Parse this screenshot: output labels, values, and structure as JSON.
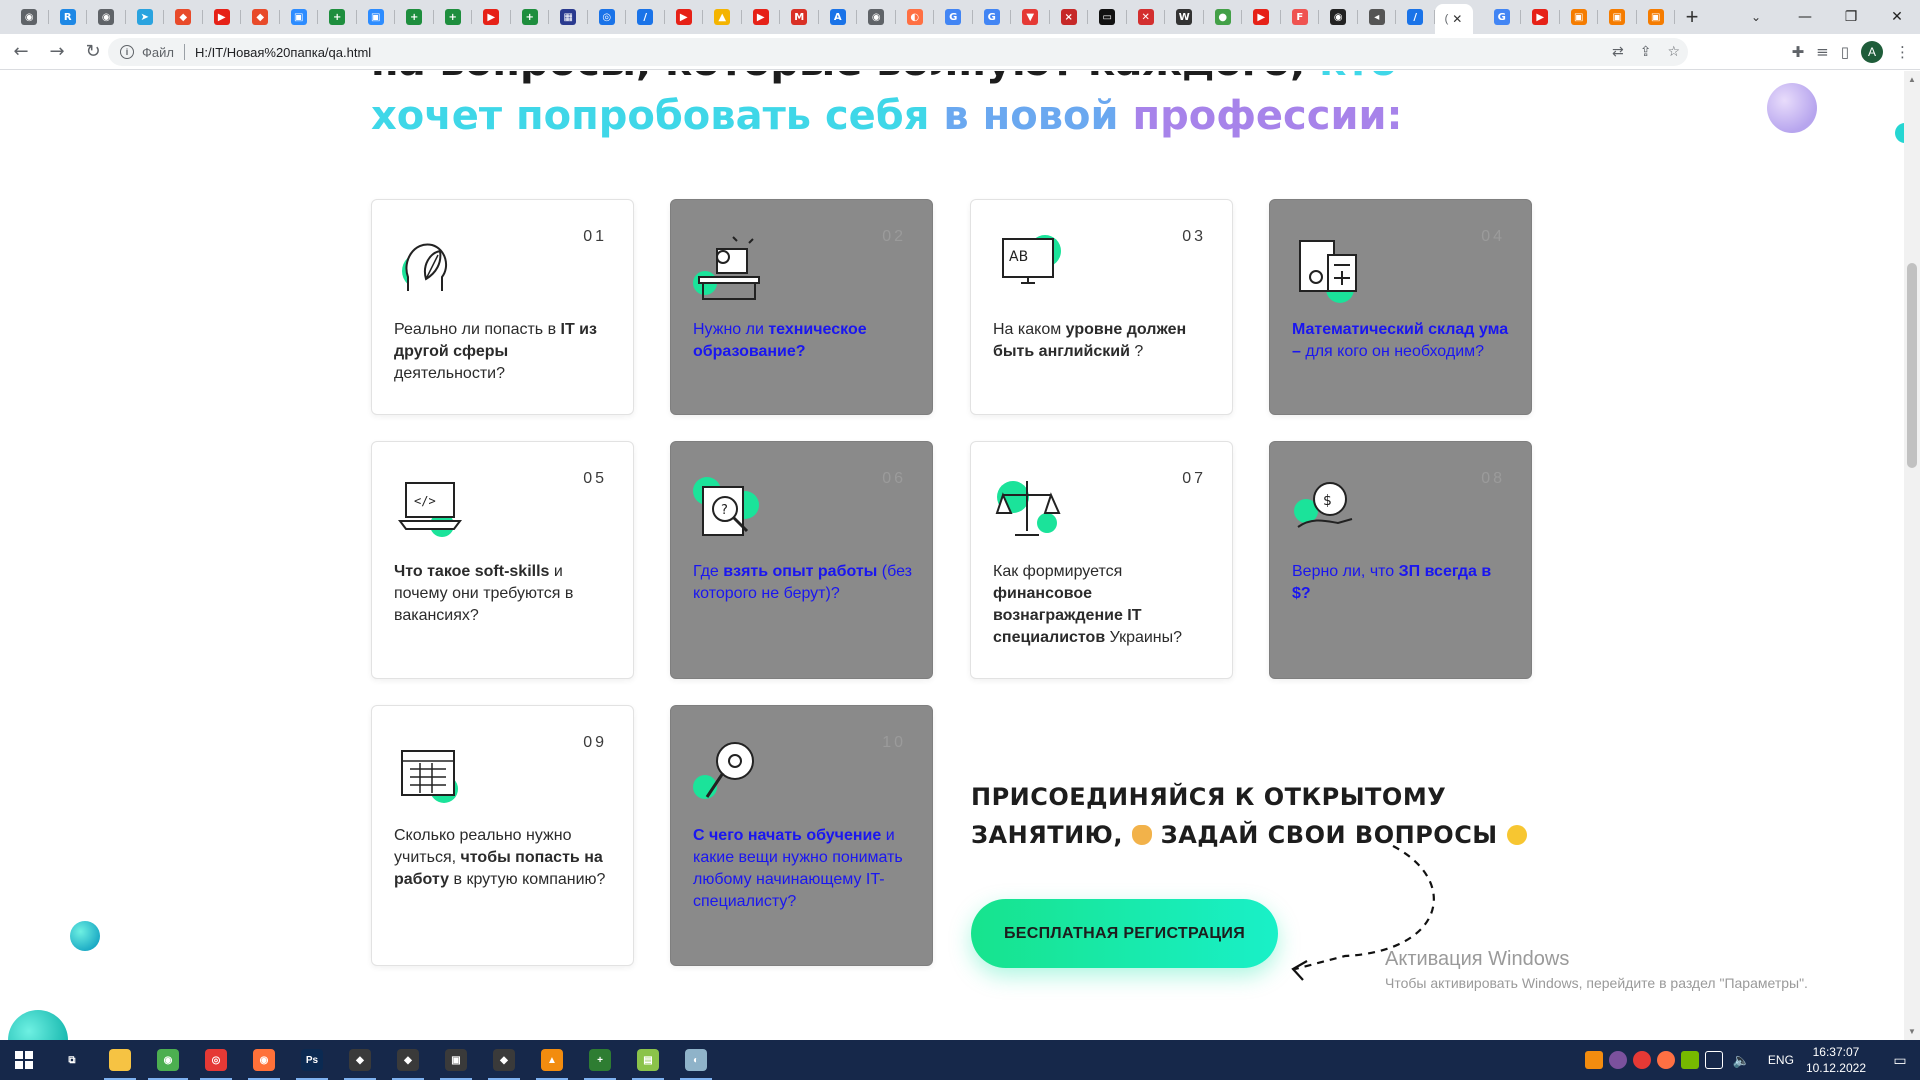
{
  "browser": {
    "tabs_pinned": [
      {
        "icon": "chrome-icon",
        "color": "#5f6368",
        "glyph": "◉"
      },
      {
        "icon": "r-icon",
        "color": "#1e88e5",
        "glyph": "R"
      },
      {
        "icon": "chrome-dark-icon",
        "color": "#5f6368",
        "glyph": "◉"
      },
      {
        "icon": "telegram-icon",
        "color": "#2aa3df",
        "glyph": "➤"
      },
      {
        "icon": "git-icon",
        "color": "#e84a2a",
        "glyph": "◆"
      },
      {
        "icon": "youtube-icon",
        "color": "#e62117",
        "glyph": "▶"
      },
      {
        "icon": "git-icon",
        "color": "#e84a2a",
        "glyph": "◆"
      },
      {
        "icon": "zoom-icon",
        "color": "#2d8cff",
        "glyph": "▣"
      },
      {
        "icon": "sheets-icon",
        "color": "#1e8e3e",
        "glyph": "+"
      },
      {
        "icon": "zoom-icon",
        "color": "#2d8cff",
        "glyph": "▣"
      },
      {
        "icon": "sheets-icon",
        "color": "#1e8e3e",
        "glyph": "+"
      },
      {
        "icon": "sheets-icon",
        "color": "#1e8e3e",
        "glyph": "+"
      },
      {
        "icon": "youtube-icon",
        "color": "#e62117",
        "glyph": "▶"
      },
      {
        "icon": "sheets-icon",
        "color": "#1e8e3e",
        "glyph": "+"
      },
      {
        "icon": "grid-icon",
        "color": "#2a3a8f",
        "glyph": "▦"
      },
      {
        "icon": "maps-icon",
        "color": "#1a73e8",
        "glyph": "◎"
      },
      {
        "icon": "pen-icon",
        "color": "#1a73e8",
        "glyph": "/"
      },
      {
        "icon": "youtube-icon",
        "color": "#e62117",
        "glyph": "▶"
      },
      {
        "icon": "drive-icon",
        "color": "#f4b400",
        "glyph": "▲"
      },
      {
        "icon": "youtube-icon",
        "color": "#e62117",
        "glyph": "▶"
      },
      {
        "icon": "gmail-icon",
        "color": "#d93025",
        "glyph": "M"
      },
      {
        "icon": "a-icon",
        "color": "#1a73e8",
        "glyph": "A"
      },
      {
        "icon": "chrome-dark-icon",
        "color": "#5f6368",
        "glyph": "◉"
      },
      {
        "icon": "swirl-icon",
        "color": "#ff7043",
        "glyph": "◐"
      },
      {
        "icon": "google-icon",
        "color": "#4285f4",
        "glyph": "G"
      },
      {
        "icon": "google-icon",
        "color": "#4285f4",
        "glyph": "G"
      },
      {
        "icon": "cup-icon",
        "color": "#e53935",
        "glyph": "▼"
      },
      {
        "icon": "xo-icon",
        "color": "#c62828",
        "glyph": "×"
      },
      {
        "icon": "tv-icon",
        "color": "#111111",
        "glyph": "▭"
      },
      {
        "icon": "x-icon",
        "color": "#d32f2f",
        "glyph": "✕"
      },
      {
        "icon": "wikipedia-icon",
        "color": "#333333",
        "glyph": "W"
      },
      {
        "icon": "green-icon",
        "color": "#43a047",
        "glyph": "●"
      },
      {
        "icon": "youtube-icon",
        "color": "#e62117",
        "glyph": "▶"
      },
      {
        "icon": "f-icon",
        "color": "#ef5350",
        "glyph": "F"
      },
      {
        "icon": "github-icon",
        "color": "#222222",
        "glyph": "◉"
      },
      {
        "icon": "sound-icon",
        "color": "#555555",
        "glyph": "◂"
      },
      {
        "icon": "pen-icon",
        "color": "#1a73e8",
        "glyph": "/"
      }
    ],
    "tabs_after": [
      {
        "icon": "google-icon",
        "color": "#4285f4",
        "glyph": "G"
      },
      {
        "icon": "youtube-icon",
        "color": "#e62117",
        "glyph": "▶"
      },
      {
        "icon": "folder-icon",
        "color": "#f57c00",
        "glyph": "▣"
      },
      {
        "icon": "folder-icon",
        "color": "#f57c00",
        "glyph": "▣"
      },
      {
        "icon": "folder-icon",
        "color": "#f57c00",
        "glyph": "▣"
      }
    ],
    "active_tab_close": "✕",
    "new_tab_label": "+",
    "address_scheme": "Файл",
    "address_url": "H:/IT/Новая%20папка/qa.html",
    "profile_initial": "A"
  },
  "page": {
    "headline_line1_dark": "на вопросы, которые волнуют каждого,",
    "headline_line1_accent": "кто",
    "headline_line2_w1": "хочет попробовать себя",
    "headline_line2_w2": "в новой",
    "headline_line2_w3": "профессии:",
    "cards": [
      {
        "num": "01",
        "theme": "light",
        "icon": "head-plant-icon",
        "pre": "Реально ли попасть в ",
        "bold": "IT из другой сферы",
        "post": " деятельности?"
      },
      {
        "num": "02",
        "theme": "dark",
        "icon": "desk-worker-icon",
        "pre": "Нужно ли ",
        "bold": "техническое образование?",
        "post": ""
      },
      {
        "num": "03",
        "theme": "light",
        "icon": "translate-monitor-icon",
        "pre": "На каком ",
        "bold": "уровне должен быть английский",
        "post": " ?"
      },
      {
        "num": "04",
        "theme": "dark",
        "icon": "calculator-docs-icon",
        "pre": "",
        "bold": "Математический склад ума –",
        "post": " для кого он необходим?"
      },
      {
        "num": "05",
        "theme": "light",
        "icon": "laptop-code-icon",
        "pre": "",
        "bold": "Что такое soft-skills",
        "post": " и почему они требуются в вакансиях?"
      },
      {
        "num": "06",
        "theme": "dark",
        "icon": "magnifier-question-icon",
        "pre": "Где ",
        "bold": "взять опыт работы",
        "post": " (без которого не берут)?"
      },
      {
        "num": "07",
        "theme": "light",
        "icon": "scales-icon",
        "pre": "Как формируется ",
        "bold": "финансовое вознаграждение IT специалистов",
        "post": " Украины?"
      },
      {
        "num": "08",
        "theme": "dark",
        "icon": "hand-coin-icon",
        "pre": "Верно ли, что ",
        "bold": "ЗП всегда в $?",
        "post": ""
      },
      {
        "num": "09",
        "theme": "light",
        "icon": "calendar-icon",
        "pre": "Сколько реально нужно учиться, ",
        "bold": "чтобы попасть на работу",
        "post": " в крутую компанию?"
      },
      {
        "num": "10",
        "theme": "dark",
        "icon": "lightbulb-gear-icon",
        "pre": "",
        "bold": "С чего начать обучение",
        "post": " и какие вещи нужно понимать любому начинающему IT-специалисту?"
      }
    ],
    "cta_line1": "ПРИСОЕДИНЯЙСЯ К ОТКРЫТОМУ",
    "cta_line2_a": "ЗАНЯТИЮ,",
    "cta_line2_b": "ЗАДАЙ СВОИ ВОПРОСЫ",
    "cta_button": "БЕСПЛАТНАЯ РЕГИСТРАЦИЯ",
    "colors": {
      "accent_green": "#17e38d",
      "accent_cyan": "#3fd7e8",
      "accent_purple": "#a783ea",
      "dark_card": "#8a8a8a",
      "dark_card_text": "#1a16f0"
    }
  },
  "os": {
    "activation_title": "Активация Windows",
    "activation_sub": "Чтобы активировать Windows, перейдите в раздел \"Параметры\".",
    "taskbar_apps": [
      {
        "icon": "task-view-icon",
        "color": "#16284a",
        "glyph": "⧉"
      },
      {
        "icon": "file-explorer-icon",
        "color": "#f6c343",
        "glyph": ""
      },
      {
        "icon": "chrome-icon",
        "color": "#4caf50",
        "glyph": "◉"
      },
      {
        "icon": "app-red-icon",
        "color": "#e53935",
        "glyph": "◎"
      },
      {
        "icon": "firefox-icon",
        "color": "#ff7139",
        "glyph": "◉"
      },
      {
        "icon": "photoshop-icon",
        "color": "#0b2a52",
        "glyph": "Ps"
      },
      {
        "icon": "game-icon",
        "color": "#3a3a3a",
        "glyph": "◆"
      },
      {
        "icon": "game-icon",
        "color": "#3a3a3a",
        "glyph": "◆"
      },
      {
        "icon": "game-icon",
        "color": "#3a3a3a",
        "glyph": "▣"
      },
      {
        "icon": "game-icon",
        "color": "#3a3a3a",
        "glyph": "◆"
      },
      {
        "icon": "vlc-icon",
        "color": "#f28c0f",
        "glyph": "▲"
      },
      {
        "icon": "app-green-icon",
        "color": "#2e7d32",
        "glyph": "+"
      },
      {
        "icon": "notepad-icon",
        "color": "#8bc34a",
        "glyph": "▤"
      },
      {
        "icon": "app-bird-icon",
        "color": "#8fb3c9",
        "glyph": "◐"
      }
    ],
    "language": "ENG",
    "time": "16:37:07",
    "date": "10.12.2022"
  }
}
